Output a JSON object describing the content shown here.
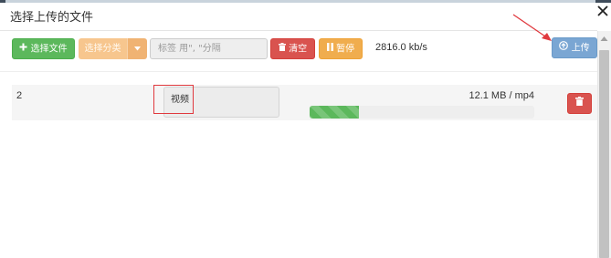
{
  "dialog": {
    "title": "选择上传的文件"
  },
  "toolbar": {
    "select_files_label": "选择文件",
    "category_label": "选择分类",
    "tags_placeholder": "标签 用\", \"分隔",
    "clear_label": "清空",
    "pause_label": "暂停",
    "speed": "2816.0 kb/s",
    "upload_label": "上传"
  },
  "files": [
    {
      "index": "2",
      "category": "视频",
      "size_type": "12.1 MB / mp4",
      "progress": 0.22
    }
  ],
  "colors": {
    "success": "#5cb85c",
    "danger": "#d9534f",
    "warning": "#f0ad4e",
    "primary_disabled": "#7aa6d3",
    "annotation": "#e0393e"
  },
  "icons": [
    "plus-icon",
    "caret-down-icon",
    "trash-icon",
    "pause-icon",
    "upload-circle-icon",
    "close-icon"
  ]
}
